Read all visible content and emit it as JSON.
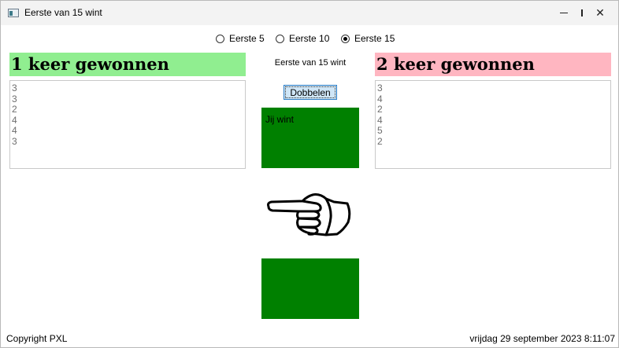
{
  "window": {
    "title": "Eerste van 15 wint"
  },
  "radio_options": [
    {
      "label": "Eerste 5",
      "checked": false
    },
    {
      "label": "Eerste 10",
      "checked": false
    },
    {
      "label": "Eerste 15",
      "checked": true
    }
  ],
  "player1": {
    "banner": "1 keer gewonnen",
    "color": "#90ee90",
    "rolls": [
      "3",
      "3",
      "2",
      "4",
      "4",
      "3"
    ]
  },
  "player2": {
    "banner": "2 keer gewonnen",
    "color": "#ffb6c1",
    "rolls": [
      "3",
      "4",
      "2",
      "4",
      "5",
      "2"
    ]
  },
  "center": {
    "status": "Eerste van 15 wint",
    "roll_button": "Dobbelen",
    "top_die_text": "Jij wint",
    "die_color": "#008000",
    "pointer_icon": "pointing-hand-left"
  },
  "footer": {
    "copyright": "Copyright PXL",
    "datetime": "vrijdag 29 september 2023 8:11:07"
  }
}
